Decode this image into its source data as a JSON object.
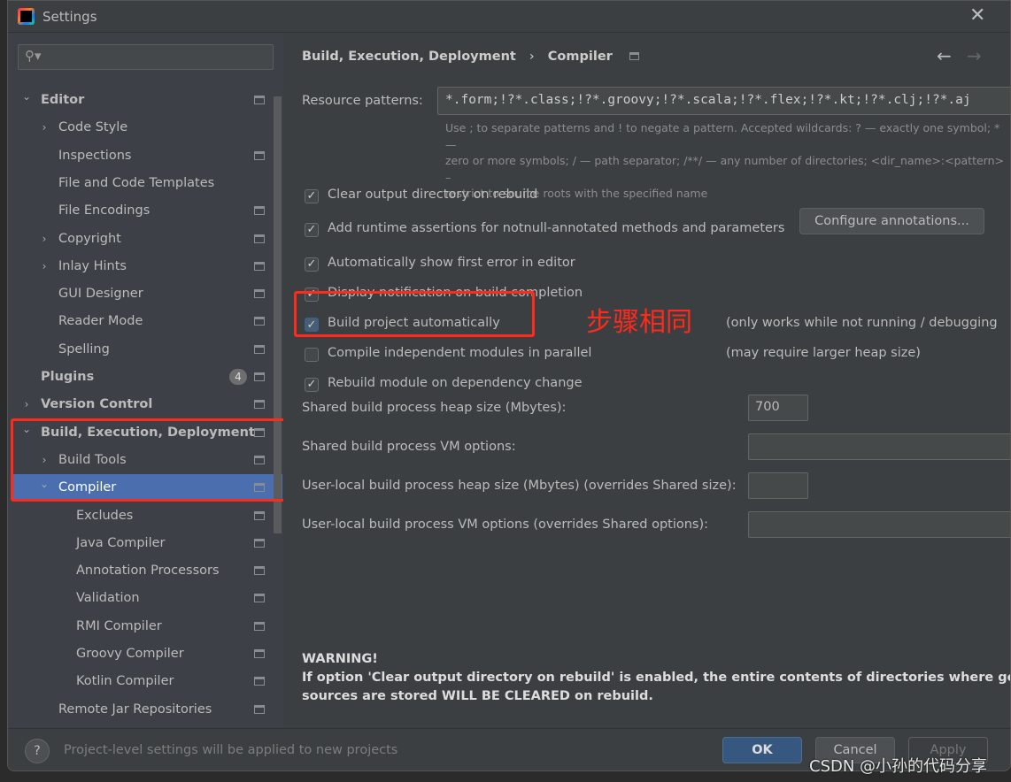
{
  "window": {
    "title": "Settings",
    "close_icon": "close-icon"
  },
  "search": {
    "placeholder": ""
  },
  "tree": [
    {
      "label": "Editor",
      "level": 0,
      "arrow": "expanded",
      "bold": true,
      "gear": true
    },
    {
      "label": "Code Style",
      "level": 1,
      "arrow": "collapsed",
      "gear": false
    },
    {
      "label": "Inspections",
      "level": 1,
      "arrow": "none",
      "gear": true
    },
    {
      "label": "File and Code Templates",
      "level": 1,
      "arrow": "none",
      "gear": false
    },
    {
      "label": "File Encodings",
      "level": 1,
      "arrow": "none",
      "gear": true
    },
    {
      "label": "Copyright",
      "level": 1,
      "arrow": "collapsed",
      "gear": true
    },
    {
      "label": "Inlay Hints",
      "level": 1,
      "arrow": "collapsed",
      "gear": true
    },
    {
      "label": "GUI Designer",
      "level": 1,
      "arrow": "none",
      "gear": true
    },
    {
      "label": "Reader Mode",
      "level": 1,
      "arrow": "none",
      "gear": true
    },
    {
      "label": "Spelling",
      "level": 1,
      "arrow": "none",
      "gear": true
    },
    {
      "label": "Plugins",
      "level": 0,
      "arrow": "none",
      "bold": true,
      "gear": true,
      "badge": "4"
    },
    {
      "label": "Version Control",
      "level": 0,
      "arrow": "collapsed",
      "bold": true,
      "gear": true
    },
    {
      "label": "Build, Execution, Deployment",
      "level": 0,
      "arrow": "expanded",
      "bold": true,
      "gear": true
    },
    {
      "label": "Build Tools",
      "level": 1,
      "arrow": "collapsed",
      "gear": true
    },
    {
      "label": "Compiler",
      "level": 1,
      "arrow": "expanded",
      "gear": true,
      "selected": true
    },
    {
      "label": "Excludes",
      "level": 2,
      "arrow": "none",
      "gear": true
    },
    {
      "label": "Java Compiler",
      "level": 2,
      "arrow": "none",
      "gear": true
    },
    {
      "label": "Annotation Processors",
      "level": 2,
      "arrow": "none",
      "gear": true
    },
    {
      "label": "Validation",
      "level": 2,
      "arrow": "none",
      "gear": true
    },
    {
      "label": "RMI Compiler",
      "level": 2,
      "arrow": "none",
      "gear": true
    },
    {
      "label": "Groovy Compiler",
      "level": 2,
      "arrow": "none",
      "gear": true
    },
    {
      "label": "Kotlin Compiler",
      "level": 2,
      "arrow": "none",
      "gear": true
    },
    {
      "label": "Remote Jar Repositories",
      "level": 1,
      "arrow": "none",
      "gear": true
    }
  ],
  "breadcrumb": {
    "parent": "Build, Execution, Deployment",
    "separator": "›",
    "current": "Compiler"
  },
  "resource": {
    "label": "Resource patterns:",
    "value": "*.form;!?*.class;!?*.groovy;!?*.scala;!?*.flex;!?*.kt;!?*.clj;!?*.aj",
    "hint1": "Use ; to separate patterns and ! to negate a pattern. Accepted wildcards: ? — exactly one symbol; * —",
    "hint2": "zero or more symbols; / — path separator; /**/ — any number of directories; <dir_name>:<pattern> –",
    "hint3": "restrict to source roots with the specified name"
  },
  "options": [
    {
      "label": "Clear output directory on rebuild",
      "checked": true
    },
    {
      "label": "Add runtime assertions for notnull-annotated methods and parameters",
      "checked": true
    },
    {
      "label": "Automatically show first error in editor",
      "checked": true
    },
    {
      "label": "Display notification on build completion",
      "checked": true
    },
    {
      "label": "Build project automatically",
      "checked": true,
      "note": "(only works while not running / debugging"
    },
    {
      "label": "Compile independent modules in parallel",
      "checked": false,
      "note": "(may require larger heap size)"
    },
    {
      "label": "Rebuild module on dependency change",
      "checked": true
    }
  ],
  "configure_button": "Configure annotations...",
  "annotation": {
    "text": "步骤相同",
    "color": "#ff2a1a"
  },
  "fields": [
    {
      "label": "Shared build process heap size (Mbytes):",
      "value": "700"
    },
    {
      "label": "Shared build process VM options:",
      "value": ""
    },
    {
      "label": "User-local build process heap size (Mbytes) (overrides Shared size):",
      "value": ""
    },
    {
      "label": "User-local build process VM options (overrides Shared options):",
      "value": ""
    }
  ],
  "warning": {
    "title": "WARNING!",
    "line1": "If option 'Clear output directory on rebuild' is enabled, the entire contents of directories where generated",
    "line2": "sources are stored WILL BE CLEARED on rebuild."
  },
  "footer": {
    "help": "?",
    "note": "Project-level settings will be applied to new projects",
    "ok": "OK",
    "cancel": "Cancel",
    "apply": "Apply"
  },
  "watermark": "CSDN @小孙的代码分享",
  "colors": {
    "selection": "#4b6eaf",
    "highlight_box": "#ff2a1a",
    "ok_button": "#365880"
  }
}
